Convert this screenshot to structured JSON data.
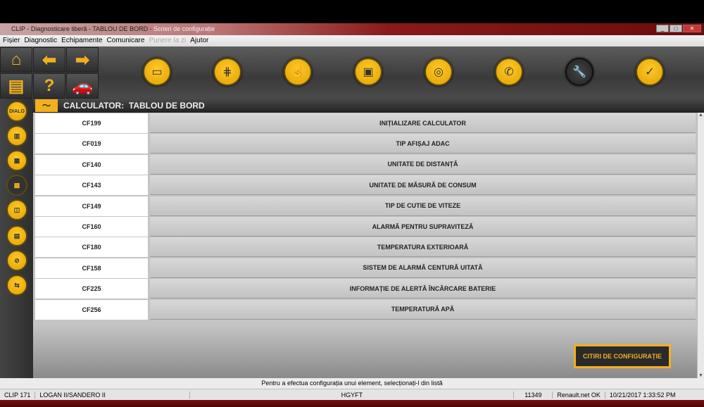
{
  "window": {
    "title_main": "CLIP - Diagnosticare liberă - TABLOU DE BORD -",
    "title_sub": "Scrieri de configurație",
    "controls": [
      "_",
      "□",
      "✕"
    ]
  },
  "menu": [
    {
      "label": "Fișier",
      "enabled": true
    },
    {
      "label": "Diagnostic",
      "enabled": true
    },
    {
      "label": "Echipamente",
      "enabled": true
    },
    {
      "label": "Comunicare",
      "enabled": true
    },
    {
      "label": "Punere la zi",
      "enabled": false
    },
    {
      "label": "Ajutor",
      "enabled": true
    }
  ],
  "toolbar": {
    "nav": [
      "home-icon",
      "back-arrow-icon",
      "forward-arrow-icon",
      "print-icon",
      "help-icon",
      "vehicle-info-icon"
    ],
    "help_glyph": "?",
    "round": [
      "vehicle-screen-icon",
      "gearbox-icon",
      "touch-icon",
      "card-icon",
      "vehicle-scan-icon",
      "phone-icon",
      "wrench-icon",
      "vehicle-check-icon"
    ]
  },
  "sidebar": {
    "first_label": "DIALO"
  },
  "calculator": {
    "label": "CALCULATOR:",
    "name": "TABLOU DE BORD"
  },
  "rows": [
    {
      "code": "CF199",
      "label": "INIȚIALIZARE CALCULATOR"
    },
    {
      "code": "CF019",
      "label": "TIP AFIȘAJ ADAC"
    },
    {
      "code": "CF140",
      "label": "UNITATE DE DISTANȚĂ"
    },
    {
      "code": "CF143",
      "label": "UNITATE DE MĂSURĂ DE CONSUM"
    },
    {
      "code": "CF149",
      "label": "TIP DE CUTIE DE VITEZE"
    },
    {
      "code": "CF160",
      "label": "ALARMĂ PENTRU SUPRAVITEZĂ"
    },
    {
      "code": "CF180",
      "label": "TEMPERATURA EXTERIOARĂ"
    },
    {
      "code": "CF158",
      "label": "SISTEM DE ALARMĂ CENTURĂ UITATĂ"
    },
    {
      "code": "CF225",
      "label": "INFORMAȚIE DE ALERTĂ ÎNCĂRCARE BATERIE"
    },
    {
      "code": "CF256",
      "label": "TEMPERATURĂ APĂ"
    }
  ],
  "read_button": "CITIRI DE CONFIGURAȚIE",
  "hint": "Pentru a efectua configurația unui element, selecționați-l din listă",
  "status": {
    "device": "CLIP 171",
    "vehicle": "LOGAN II/SANDERO II",
    "vin": "HGYFT",
    "code": "11349",
    "network": "Renault.net OK",
    "datetime": "10/21/2017 1:33:52 PM"
  }
}
